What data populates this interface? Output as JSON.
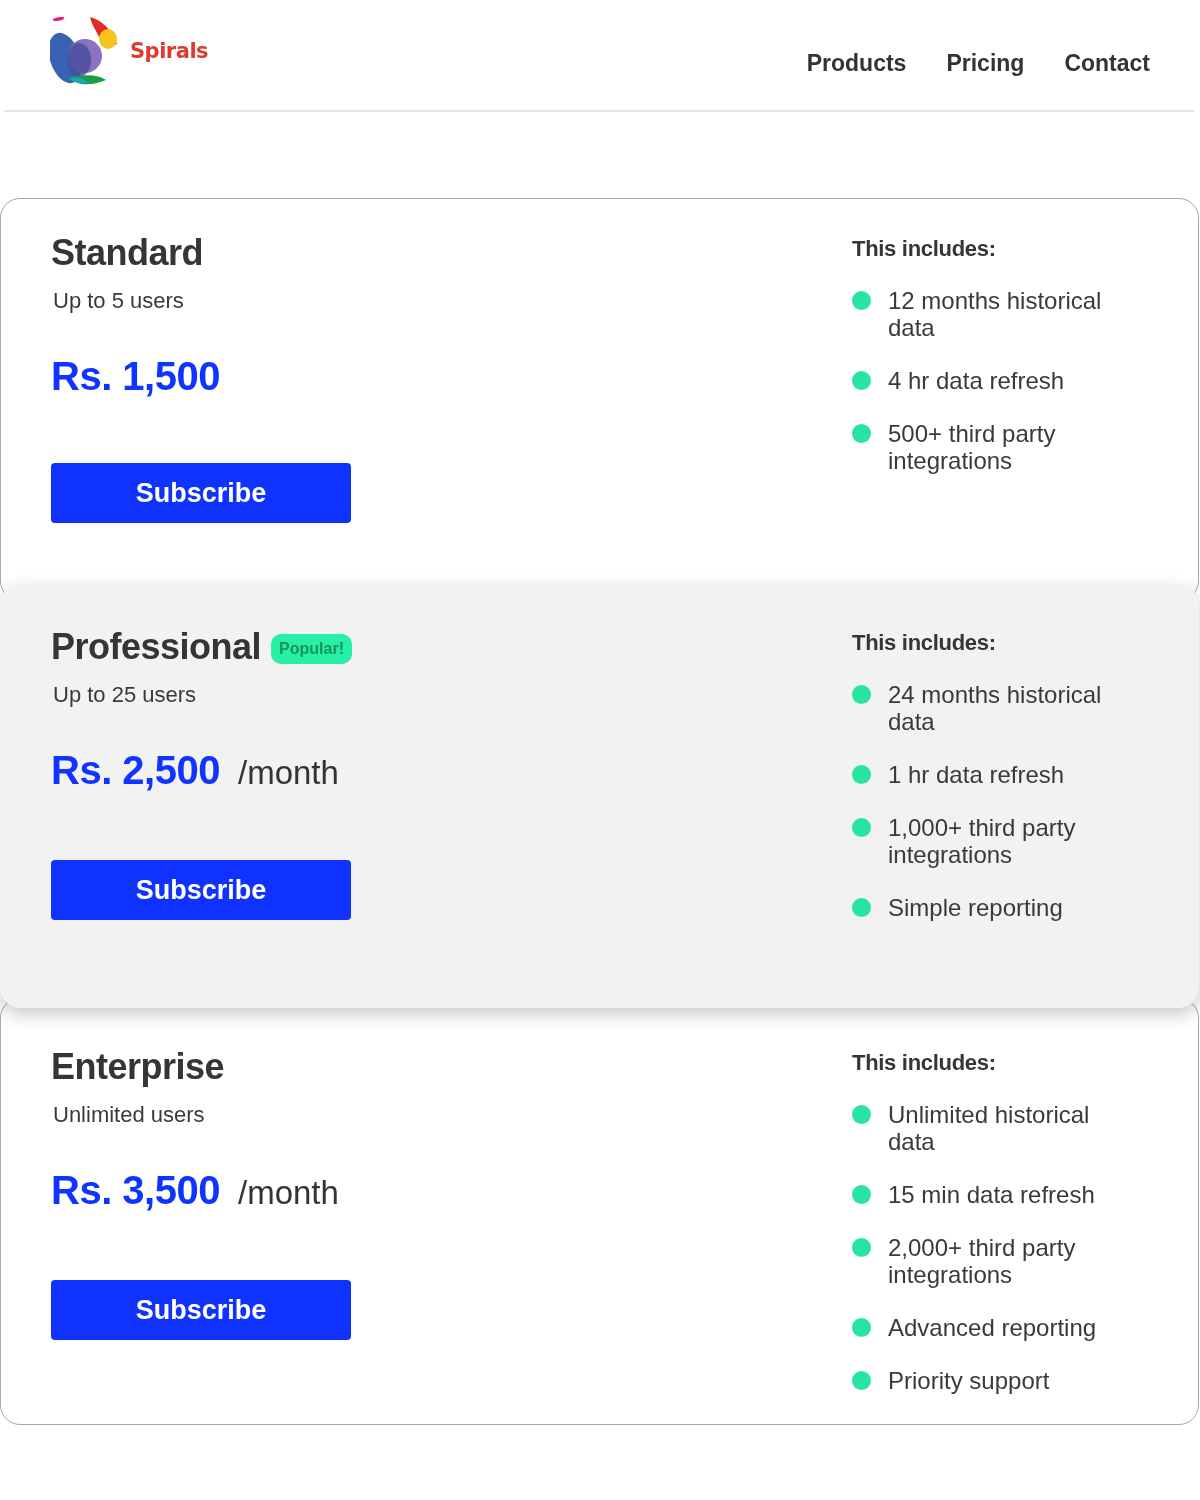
{
  "header": {
    "brand": "Spirals",
    "nav": [
      {
        "label": "Products"
      },
      {
        "label": "Pricing"
      },
      {
        "label": "Contact"
      }
    ]
  },
  "plans": [
    {
      "name": "Standard",
      "highlighted": false,
      "users": "Up to 5 users",
      "price": "Rs. 1,500",
      "button": "Subscribe",
      "features_heading": "This includes:",
      "features": [
        "12 months historical data",
        "4 hr data refresh",
        "500+ third party integrations"
      ]
    },
    {
      "name": "Professional",
      "badge": "Popular!",
      "highlighted": true,
      "users": "Up to 25 users",
      "price": "Rs. 2,500",
      "period": "/month",
      "button": "Subscribe",
      "features_heading": "This includes:",
      "features": [
        "24 months historical data",
        "1 hr data refresh",
        "1,000+ third party integrations",
        "Simple reporting"
      ]
    },
    {
      "name": "Enterprise",
      "highlighted": false,
      "users": "Unlimited users",
      "price": "Rs. 3,500",
      "period": "/month",
      "button": "Subscribe",
      "features_heading": "This includes:",
      "features": [
        "Unlimited historical data",
        "15 min data refresh",
        "2,000+ third party integrations",
        "Advanced reporting",
        "Priority support"
      ]
    }
  ]
}
